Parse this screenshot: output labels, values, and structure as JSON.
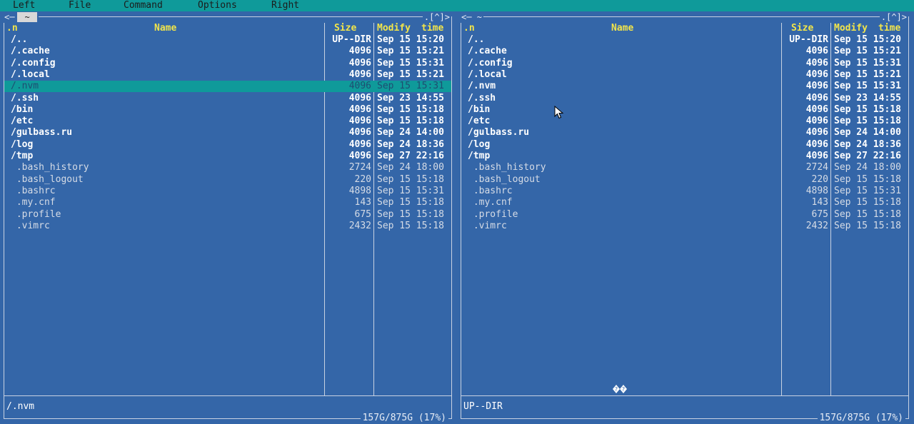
{
  "menubar": {
    "left": "Left",
    "file": "File",
    "command": "Command",
    "options": "Options",
    "right": "Right"
  },
  "left_panel": {
    "nav_arrows": "<─",
    "path": "~",
    "controls": ".[^]>",
    "columns": {
      "sort": ".n",
      "name": "Name",
      "size": "Size",
      "modify": "Modify",
      "time": "time"
    },
    "rows": [
      {
        "name": "/..",
        "size": "UP--DIR",
        "date": "Sep 15 15:20",
        "type": "dir"
      },
      {
        "name": "/.cache",
        "size": "4096",
        "date": "Sep 15 15:21",
        "type": "dir"
      },
      {
        "name": "/.config",
        "size": "4096",
        "date": "Sep 15 15:31",
        "type": "dir"
      },
      {
        "name": "/.local",
        "size": "4096",
        "date": "Sep 15 15:21",
        "type": "dir"
      },
      {
        "name": "/.nvm",
        "size": "4096",
        "date": "Sep 15 15:31",
        "type": "dir",
        "selected": true
      },
      {
        "name": "/.ssh",
        "size": "4096",
        "date": "Sep 23 14:55",
        "type": "dir"
      },
      {
        "name": "/bin",
        "size": "4096",
        "date": "Sep 15 15:18",
        "type": "dir"
      },
      {
        "name": "/etc",
        "size": "4096",
        "date": "Sep 15 15:18",
        "type": "dir"
      },
      {
        "name": "/gulbass.ru",
        "size": "4096",
        "date": "Sep 24 14:00",
        "type": "dir"
      },
      {
        "name": "/log",
        "size": "4096",
        "date": "Sep 24 18:36",
        "type": "dir"
      },
      {
        "name": "/tmp",
        "size": "4096",
        "date": "Sep 27 22:16",
        "type": "dir"
      },
      {
        "name": " .bash_history",
        "size": "2724",
        "date": "Sep 24 18:00",
        "type": "file"
      },
      {
        "name": " .bash_logout",
        "size": "220",
        "date": "Sep 15 15:18",
        "type": "file"
      },
      {
        "name": " .bashrc",
        "size": "4898",
        "date": "Sep 15 15:31",
        "type": "file"
      },
      {
        "name": " .my.cnf",
        "size": "143",
        "date": "Sep 15 15:18",
        "type": "file"
      },
      {
        "name": " .profile",
        "size": "675",
        "date": "Sep 15 15:18",
        "type": "file"
      },
      {
        "name": " .vimrc",
        "size": "2432",
        "date": "Sep 15 15:18",
        "type": "file"
      }
    ],
    "status": "/.nvm",
    "disk": "157G/875G (17%)"
  },
  "right_panel": {
    "nav_arrows": "<─",
    "path": "~",
    "controls": ".[^]>",
    "columns": {
      "sort": ".n",
      "name": "Name",
      "size": "Size",
      "modify": "Modify",
      "time": "time"
    },
    "rows": [
      {
        "name": "/..",
        "size": "UP--DIR",
        "date": "Sep 15 15:20",
        "type": "dir"
      },
      {
        "name": "/.cache",
        "size": "4096",
        "date": "Sep 15 15:21",
        "type": "dir"
      },
      {
        "name": "/.config",
        "size": "4096",
        "date": "Sep 15 15:31",
        "type": "dir"
      },
      {
        "name": "/.local",
        "size": "4096",
        "date": "Sep 15 15:21",
        "type": "dir"
      },
      {
        "name": "/.nvm",
        "size": "4096",
        "date": "Sep 15 15:31",
        "type": "dir"
      },
      {
        "name": "/.ssh",
        "size": "4096",
        "date": "Sep 23 14:55",
        "type": "dir"
      },
      {
        "name": "/bin",
        "size": "4096",
        "date": "Sep 15 15:18",
        "type": "dir"
      },
      {
        "name": "/etc",
        "size": "4096",
        "date": "Sep 15 15:18",
        "type": "dir"
      },
      {
        "name": "/gulbass.ru",
        "size": "4096",
        "date": "Sep 24 14:00",
        "type": "dir"
      },
      {
        "name": "/log",
        "size": "4096",
        "date": "Sep 24 18:36",
        "type": "dir"
      },
      {
        "name": "/tmp",
        "size": "4096",
        "date": "Sep 27 22:16",
        "type": "dir"
      },
      {
        "name": " .bash_history",
        "size": "2724",
        "date": "Sep 24 18:00",
        "type": "file"
      },
      {
        "name": " .bash_logout",
        "size": "220",
        "date": "Sep 15 15:18",
        "type": "file"
      },
      {
        "name": " .bashrc",
        "size": "4898",
        "date": "Sep 15 15:31",
        "type": "file"
      },
      {
        "name": " .my.cnf",
        "size": "143",
        "date": "Sep 15 15:18",
        "type": "file"
      },
      {
        "name": " .profile",
        "size": "675",
        "date": "Sep 15 15:18",
        "type": "file"
      },
      {
        "name": " .vimrc",
        "size": "2432",
        "date": "Sep 15 15:18",
        "type": "file"
      }
    ],
    "status": "UP--DIR",
    "disk": "157G/875G (17%)"
  },
  "icons": {
    "cursor": "mouse-pointer-icon",
    "swap": "panel-swap-icon"
  },
  "colors": {
    "background": "#3466a8",
    "menubar": "#0f9a9a",
    "selection": "#0f9a9a",
    "header_text": "#f2e54a"
  }
}
